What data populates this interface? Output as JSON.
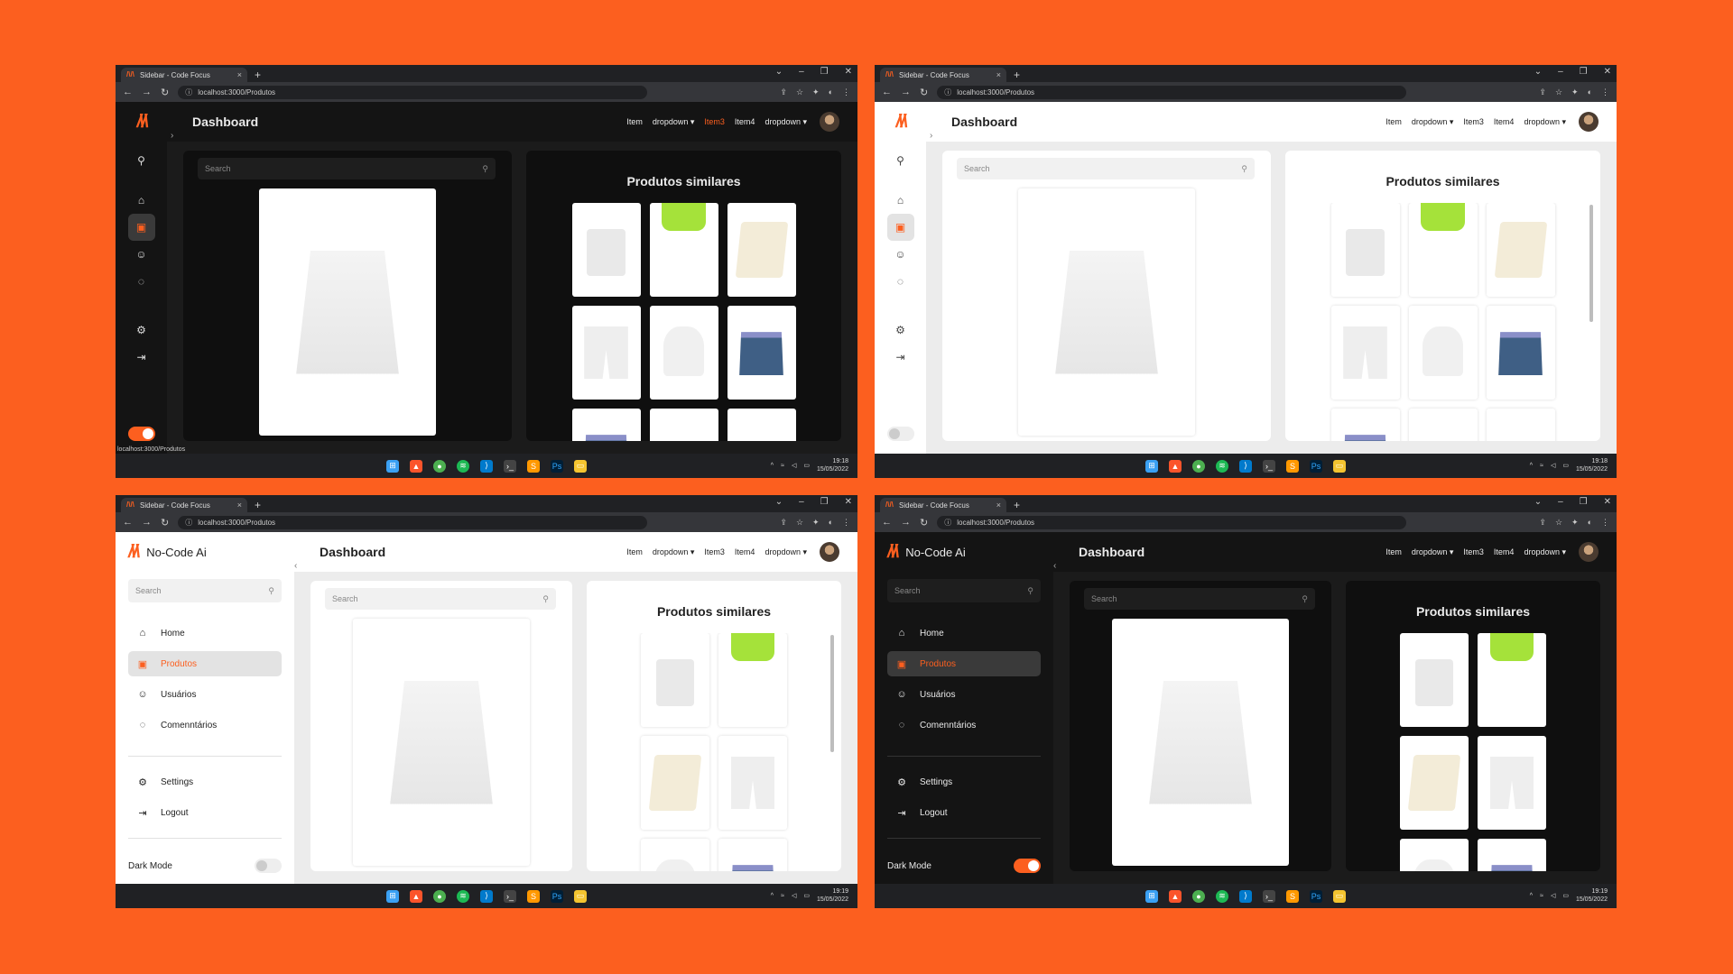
{
  "browser": {
    "tab_title": "Sidebar - Code Focus",
    "url": "localhost:3000/Produtos",
    "new_tab": "+",
    "tab_close": "×",
    "window_controls": [
      "⌄",
      "–",
      "❐",
      "✕"
    ]
  },
  "app": {
    "brand_name": "No-Code Ai",
    "page_title": "Dashboard",
    "nav_items": [
      "Item",
      "dropdown",
      "Item3",
      "Item4",
      "dropdown"
    ],
    "search_placeholder": "Search",
    "sidebar_items": [
      "Home",
      "Produtos",
      "Usuários",
      "Comenntários"
    ],
    "sidebar_bottom_items": [
      "Settings",
      "Logout"
    ],
    "dark_mode_label": "Dark Mode",
    "similar_title": "Produtos similares",
    "status_url": "localhost:3000/Produtos"
  },
  "taskbar": {
    "times": [
      "19:18",
      "19:18",
      "19:19",
      "19:19"
    ],
    "date": "15/05/2022"
  },
  "colors": {
    "background": "#fc5f1f",
    "accent": "#fc5f1f",
    "dark": "#141414",
    "light": "#ffffff"
  },
  "icons": [
    "search-icon",
    "home-icon",
    "bag-icon",
    "user-icon",
    "comment-icon",
    "gear-icon",
    "logout-icon",
    "sun-icon"
  ]
}
